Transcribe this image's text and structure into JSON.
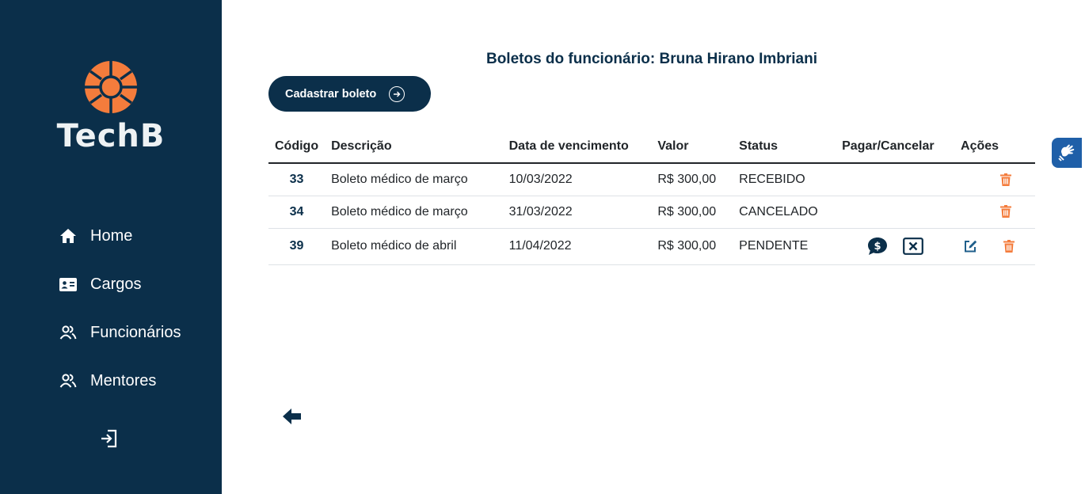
{
  "brand": {
    "name": "TechB",
    "accent": "#f47c3c",
    "primary": "#0b2f4a"
  },
  "sidebar": {
    "items": [
      {
        "label": "Home",
        "icon": "home-icon"
      },
      {
        "label": "Cargos",
        "icon": "id-card-icon"
      },
      {
        "label": "Funcionários",
        "icon": "users-icon"
      },
      {
        "label": "Mentores",
        "icon": "users-icon"
      }
    ],
    "logout_icon": "logout-icon"
  },
  "main": {
    "title": "Boletos do funcionário: Bruna Hirano Imbriani",
    "add_button_label": "Cadastrar boleto",
    "table": {
      "headers": [
        "Código",
        "Descrição",
        "Data de vencimento",
        "Valor",
        "Status",
        "Pagar/Cancelar",
        "Ações"
      ],
      "rows": [
        {
          "codigo": "33",
          "descricao": "Boleto médico de março",
          "vencimento": "10/03/2022",
          "valor": "R$ 300,00",
          "status": "RECEBIDO"
        },
        {
          "codigo": "34",
          "descricao": "Boleto médico de março",
          "vencimento": "31/03/2022",
          "valor": "R$ 300,00",
          "status": "CANCELADO"
        },
        {
          "codigo": "39",
          "descricao": "Boleto médico de abril",
          "vencimento": "11/04/2022",
          "valor": "R$ 300,00",
          "status": "PENDENTE"
        }
      ]
    }
  },
  "colors": {
    "delete": "#f47c3c",
    "edit": "#1f5f8b",
    "a11y": "#1f5fa8"
  }
}
